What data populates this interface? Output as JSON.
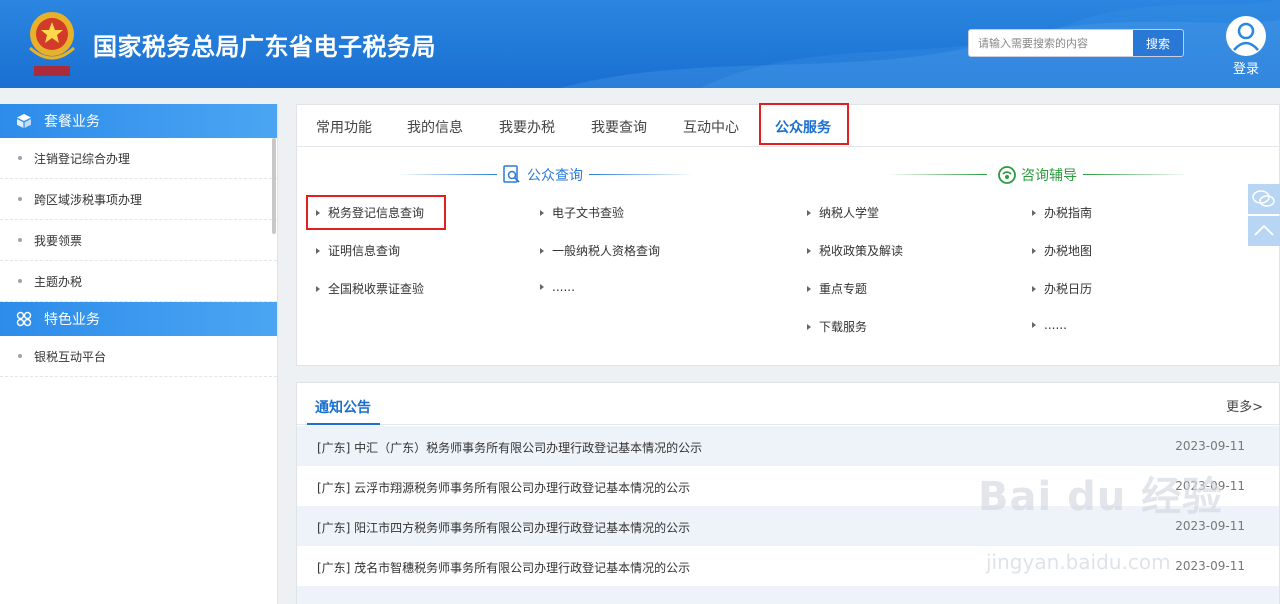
{
  "header": {
    "site_title": "国家税务总局广东省电子税务局",
    "search_placeholder": "请输入需要搜索的内容",
    "search_label": "搜索",
    "login_label": "登录",
    "emblem_text": "中国税务"
  },
  "sidebar": {
    "sections": [
      {
        "title": "套餐业务",
        "icon": "cube-icon",
        "items": [
          "注销登记综合办理",
          "跨区域涉税事项办理",
          "我要领票",
          "主题办税"
        ]
      },
      {
        "title": "特色业务",
        "icon": "grid-icon",
        "items": [
          "银税互动平台"
        ]
      }
    ]
  },
  "tabs": [
    "常用功能",
    "我的信息",
    "我要办税",
    "我要查询",
    "互动中心",
    "公众服务"
  ],
  "active_tab": "公众服务",
  "public_query": {
    "title": "公众查询",
    "col1": [
      "税务登记信息查询",
      "证明信息查询",
      "全国税收票证查验"
    ],
    "col2": [
      "电子文书查验",
      "一般纳税人资格查询",
      "......"
    ]
  },
  "consult": {
    "title": "咨询辅导",
    "col1": [
      "纳税人学堂",
      "税收政策及解读",
      "重点专题",
      "下载服务"
    ],
    "col2": [
      "办税指南",
      "办税地图",
      "办税日历",
      "......"
    ]
  },
  "notice": {
    "title": "通知公告",
    "more": "更多>",
    "rows": [
      {
        "text": "[广东] 中汇（广东）税务师事务所有限公司办理行政登记基本情况的公示",
        "date": "2023-09-11"
      },
      {
        "text": "[广东] 云浮市翔源税务师事务所有限公司办理行政登记基本情况的公示",
        "date": "2023-09-11"
      },
      {
        "text": "[广东] 阳江市四方税务师事务所有限公司办理行政登记基本情况的公示",
        "date": "2023-09-11"
      },
      {
        "text": "[广东] 茂名市智穗税务师事务所有限公司办理行政登记基本情况的公示",
        "date": "2023-09-11"
      }
    ]
  },
  "watermark": {
    "main": "Bai du 经验",
    "sub": "jingyan.baidu.com"
  },
  "colors": {
    "brand": "#1a6fd1",
    "highlight": "#e02020",
    "consult_green": "#2b9b3d"
  }
}
